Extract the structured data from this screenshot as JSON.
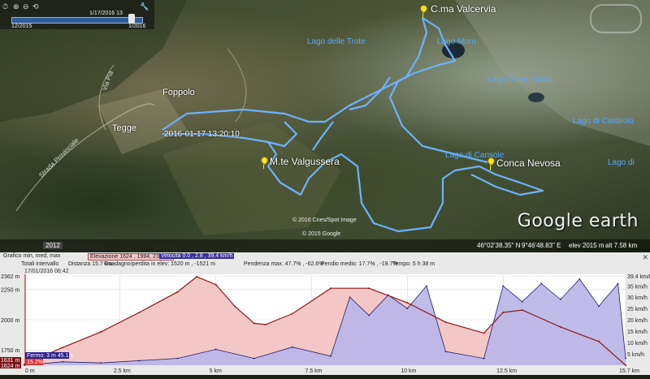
{
  "map": {
    "time_slider": {
      "start": "12/2015",
      "end": "1/2016",
      "current": "1/17/2016 13"
    },
    "places": [
      "Tegge",
      "Foppolo"
    ],
    "roads": [
      "Strada Provinciale",
      "Via Pia"
    ],
    "lakes": [
      "Lago delle Trote",
      "Lago Moro",
      "Lago Corno Stella",
      "Lago di Caldirolo",
      "Lago di Carisole",
      "Lago di"
    ],
    "pins": [
      "C.ma Valcervia",
      "M.te Valgussera",
      "Conca Nevosa"
    ],
    "track_timestamp": "2016-01-17 13:20:10",
    "copyrights": [
      "© 2016 Cnes/Spot Image",
      "© 2015 Google"
    ],
    "logo": "Google earth",
    "status": {
      "year": "2012",
      "lat": "46°02'38.35\" N",
      "lon": "9°46'48.83\" E",
      "elev": "elev  2015 m",
      "alt": "alt  7.58 km"
    },
    "colors": {
      "track": "#6cb2ff",
      "elevation_fill": "#f4c7c7",
      "elevation_line": "#8b1a1a",
      "speed_fill": "#b9b5e8",
      "speed_line": "#1f1a6b"
    }
  },
  "profile": {
    "row1": {
      "label": "Grafico  min, med, max",
      "elev": "Elevazione  1624 , 1994, 2362 m",
      "speed": "Velocità  0.0 , 2.8 , 39.4 km/h"
    },
    "row2": {
      "label": "Totali intervallo",
      "dist": "Distanza  15.7 km",
      "gain": "Guadagno/perdita in elev:  1520 m , -1521 m",
      "slope_max": "Pendenza max:  47.7% , -62.6%",
      "slope_avg": "Pendio medio:  17.7% , -19.7%",
      "time": "Tempo:  5 h 38 m"
    },
    "date": "17/01/2016 06:42",
    "close": "✕",
    "left_axis": [
      "2362 m",
      "2250 m",
      "2000 m",
      "1750 m",
      "1631 m",
      "1624 m"
    ],
    "right_axis": [
      "39.4 km/h",
      "35 km/h",
      "30 km/h",
      "25 km/h",
      "20 km/h",
      "15 km/h",
      "10 km/h",
      "5 km/h"
    ],
    "x_axis": [
      "0 m",
      "2.5 km",
      "5 km",
      "7.5 km",
      "10 km",
      "12.5 km",
      "15.7 km"
    ],
    "marker": {
      "label": "Fermo:  3 m 45.1 s",
      "slope": "15.2%"
    }
  },
  "chart_data": {
    "type": "area",
    "title": "",
    "xlabel": "",
    "ylabel": "",
    "x_unit": "km",
    "xlim": [
      0,
      15.7
    ],
    "ylim_left": [
      1624,
      2362
    ],
    "ylim_right": [
      0,
      39.4
    ],
    "grid": true,
    "series": [
      {
        "name": "Elevazione",
        "axis": "left",
        "x": [
          0,
          1,
          2,
          3,
          4,
          4.5,
          5,
          5.5,
          6,
          6.3,
          7,
          8,
          9,
          10,
          11,
          12,
          12.5,
          13,
          14,
          15,
          15.7
        ],
        "values": [
          1631,
          1770,
          1900,
          2060,
          2230,
          2355,
          2290,
          2110,
          1970,
          1960,
          2050,
          2260,
          2260,
          2140,
          1980,
          1890,
          2060,
          2080,
          1940,
          1820,
          1624
        ]
      },
      {
        "name": "Velocità",
        "axis": "right",
        "x": [
          0,
          1,
          2,
          3,
          4,
          5,
          6,
          7,
          8,
          8.5,
          9,
          9.5,
          10,
          10.5,
          11,
          12,
          12.5,
          13,
          13.5,
          14,
          14.5,
          15,
          15.5,
          15.7
        ],
        "values": [
          0,
          1.5,
          1.0,
          2.0,
          3.0,
          7.0,
          3.0,
          8.0,
          4.0,
          30.0,
          22.0,
          31.0,
          25.0,
          35.0,
          6.0,
          3.0,
          35.0,
          28.0,
          36.0,
          29.0,
          38.0,
          26.0,
          36.0,
          3.0
        ]
      }
    ]
  }
}
